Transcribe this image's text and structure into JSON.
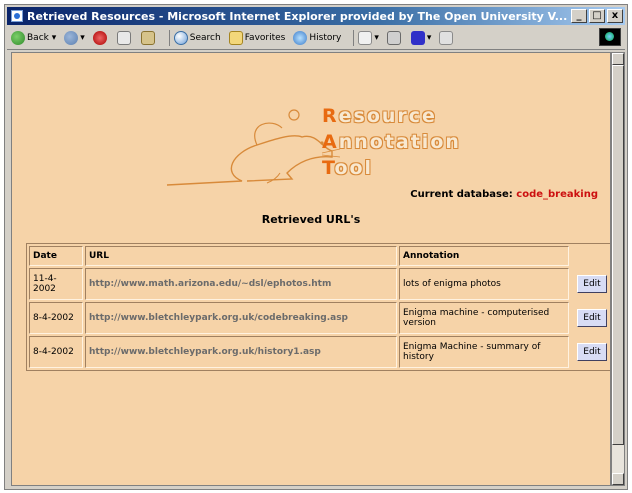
{
  "window": {
    "title": "Retrieved Resources - Microsoft Internet Explorer provided by The Open University V...",
    "minimize": "_",
    "maximize": "□",
    "close": "x"
  },
  "toolbar": {
    "back_label": "Back",
    "search_label": "Search",
    "favorites_label": "Favorites",
    "history_label": "History"
  },
  "logo": {
    "line1_initial": "R",
    "line1_rest": "esource",
    "line2_initial": "A",
    "line2_rest": "nnotation",
    "line3_initial": "T",
    "line3_rest": "ool"
  },
  "database": {
    "label": "Current database:",
    "value": "code_breaking"
  },
  "page_heading": "Retrieved URL's",
  "table": {
    "headers": {
      "date": "Date",
      "url": "URL",
      "annotation": "Annotation"
    },
    "rows": [
      {
        "date": "11-4-2002",
        "url": "http://www.math.arizona.edu/~dsl/ephotos.htm",
        "annotation": "lots of enigma photos",
        "button": "Edit"
      },
      {
        "date": "8-4-2002",
        "url": "http://www.bletchleypark.org.uk/codebreaking.asp",
        "annotation": "Enigma machine - computerised version",
        "button": "Edit"
      },
      {
        "date": "8-4-2002",
        "url": "http://www.bletchleypark.org.uk/history1.asp",
        "annotation": "Enigma Machine - summary of history",
        "button": "Edit"
      }
    ]
  }
}
